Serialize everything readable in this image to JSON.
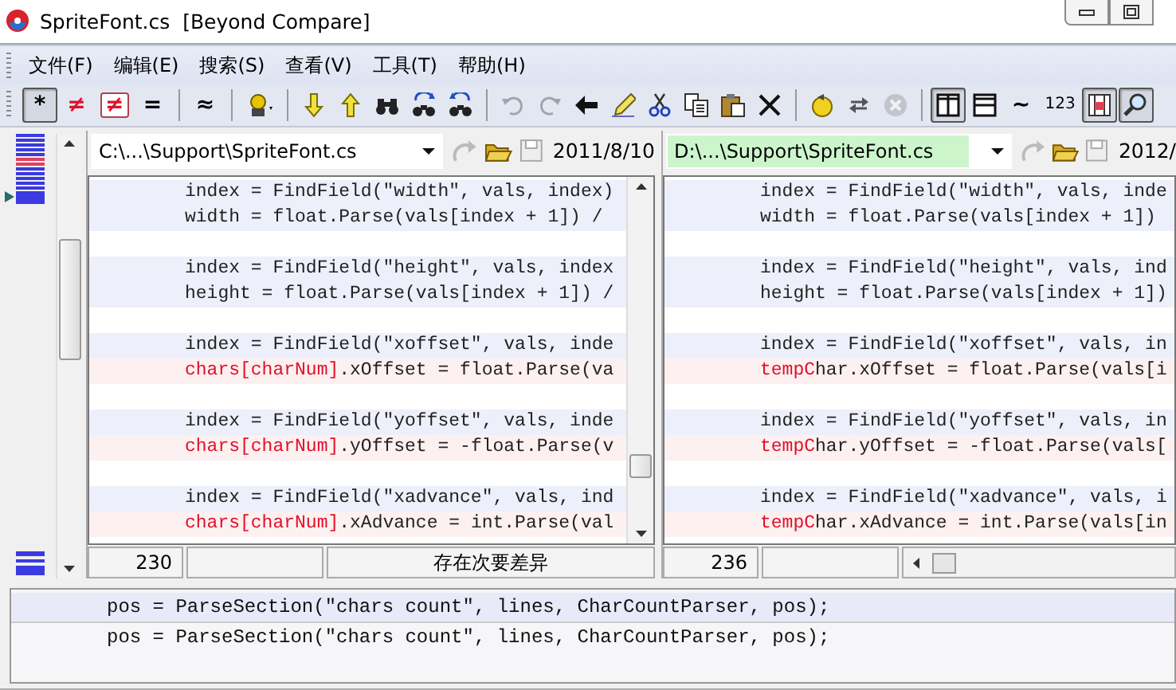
{
  "window": {
    "title": "SpriteFont.cs  [Beyond Compare]"
  },
  "menu": [
    "文件(F)",
    "编辑(E)",
    "搜索(S)",
    "查看(V)",
    "工具(T)",
    "帮助(H)"
  ],
  "toolbar": [
    {
      "kind": "glyph",
      "text": "*",
      "color": "#000000",
      "pressed": true
    },
    {
      "kind": "glyph",
      "text": "≠",
      "color": "#e0102a",
      "pressed": false
    },
    {
      "kind": "glyph-boxed",
      "text": "≠",
      "color": "#e0102a",
      "pressed": false
    },
    {
      "kind": "glyph",
      "text": "=",
      "color": "#000000",
      "pressed": false
    },
    {
      "kind": "separator"
    },
    {
      "kind": "glyph",
      "text": "≈",
      "color": "#000000",
      "pressed": false
    },
    {
      "kind": "separator"
    },
    {
      "kind": "icon",
      "pressed": false,
      "disabled": false
    },
    {
      "kind": "separator"
    },
    {
      "kind": "icon",
      "pressed": false,
      "disabled": false
    },
    {
      "kind": "icon",
      "pressed": false,
      "disabled": false
    },
    {
      "kind": "icon",
      "pressed": false,
      "disabled": false
    },
    {
      "kind": "icon",
      "pressed": false,
      "disabled": false
    },
    {
      "kind": "icon",
      "pressed": false,
      "disabled": false
    },
    {
      "kind": "separator"
    },
    {
      "kind": "icon",
      "pressed": false,
      "disabled": true
    },
    {
      "kind": "icon",
      "pressed": false,
      "disabled": true
    },
    {
      "kind": "icon",
      "pressed": false,
      "disabled": false
    },
    {
      "kind": "icon",
      "pressed": false,
      "disabled": false
    },
    {
      "kind": "icon",
      "pressed": false,
      "disabled": false
    },
    {
      "kind": "icon",
      "pressed": false,
      "disabled": false
    },
    {
      "kind": "icon",
      "pressed": false,
      "disabled": false
    },
    {
      "kind": "icon",
      "pressed": false,
      "disabled": false
    },
    {
      "kind": "separator"
    },
    {
      "kind": "icon",
      "pressed": false,
      "disabled": false
    },
    {
      "kind": "icon",
      "pressed": false,
      "disabled": false
    },
    {
      "kind": "icon",
      "pressed": false,
      "disabled": true
    },
    {
      "kind": "separator"
    },
    {
      "kind": "icon",
      "pressed": true,
      "disabled": false
    },
    {
      "kind": "icon",
      "pressed": false,
      "disabled": false
    },
    {
      "kind": "glyph",
      "text": "~",
      "color": "#000000",
      "pressed": false
    },
    {
      "kind": "glyph-small",
      "text": "123",
      "color": "#000000",
      "pressed": false
    },
    {
      "kind": "icon",
      "pressed": true,
      "disabled": false
    },
    {
      "kind": "icon",
      "pressed": true,
      "disabled": false
    }
  ],
  "panes": [
    {
      "path": "C:\\...\\Support\\SpriteFont.cs",
      "highlighted": false,
      "date": "2011/8/10",
      "vertical_scrollbar": true,
      "lines": [
        {
          "kind": "same",
          "text": "index = FindField(\"width\", vals, index)"
        },
        {
          "kind": "same",
          "text": "width = float.Parse(vals[index + 1]) /"
        },
        {
          "kind": "blank"
        },
        {
          "kind": "same",
          "text": "index = FindField(\"height\", vals, index"
        },
        {
          "kind": "same",
          "text": "height = float.Parse(vals[index + 1]) /"
        },
        {
          "kind": "blank"
        },
        {
          "kind": "same",
          "text": "index = FindField(\"xoffset\", vals, inde"
        },
        {
          "kind": "diff",
          "parts": [
            {
              "text": "chars[charNum]",
              "changed": true
            },
            {
              "text": ".xOffset = float.Parse(va",
              "changed": false
            }
          ]
        },
        {
          "kind": "blank"
        },
        {
          "kind": "same",
          "text": "index = FindField(\"yoffset\", vals, inde"
        },
        {
          "kind": "diff",
          "parts": [
            {
              "text": "chars[charNum]",
              "changed": true
            },
            {
              "text": ".yOffset = -float.Parse(v",
              "changed": false
            }
          ]
        },
        {
          "kind": "blank"
        },
        {
          "kind": "same",
          "text": "index = FindField(\"xadvance\", vals, ind"
        },
        {
          "kind": "diff",
          "parts": [
            {
              "text": "chars[charNum]",
              "changed": true
            },
            {
              "text": ".xAdvance = int.Parse(val",
              "changed": false
            }
          ]
        }
      ],
      "status": {
        "line": "230",
        "message": "存在次要差异",
        "horizontal_scrollbar": false
      }
    },
    {
      "path": "D:\\...\\Support\\SpriteFont.cs",
      "highlighted": true,
      "date": "2012/",
      "vertical_scrollbar": false,
      "lines": [
        {
          "kind": "same",
          "text": "index = FindField(\"width\", vals, inde"
        },
        {
          "kind": "same",
          "text": "width = float.Parse(vals[index + 1])"
        },
        {
          "kind": "blank"
        },
        {
          "kind": "same",
          "text": "index = FindField(\"height\", vals, ind"
        },
        {
          "kind": "same",
          "text": "height = float.Parse(vals[index + 1])"
        },
        {
          "kind": "blank"
        },
        {
          "kind": "same",
          "text": "index = FindField(\"xoffset\", vals, in"
        },
        {
          "kind": "diff",
          "parts": [
            {
              "text": "tempC",
              "changed": true
            },
            {
              "text": "har.xOffset = float.Parse(vals[i",
              "changed": false
            }
          ]
        },
        {
          "kind": "blank"
        },
        {
          "kind": "same",
          "text": "index = FindField(\"yoffset\", vals, in"
        },
        {
          "kind": "diff",
          "parts": [
            {
              "text": "tempC",
              "changed": true
            },
            {
              "text": "har.yOffset = -float.Parse(vals[",
              "changed": false
            }
          ]
        },
        {
          "kind": "blank"
        },
        {
          "kind": "same",
          "text": "index = FindField(\"xadvance\", vals, i"
        },
        {
          "kind": "diff",
          "parts": [
            {
              "text": "tempC",
              "changed": true
            },
            {
              "text": "har.xAdvance = int.Parse(vals[in",
              "changed": false
            }
          ]
        }
      ],
      "status": {
        "line": "236",
        "horizontal_scrollbar": true
      }
    }
  ],
  "compare_lines": [
    {
      "text": "pos = ParseSection(\"chars count\", lines, CharCountParser, pos);",
      "selected": true
    },
    {
      "text": "pos = ParseSection(\"chars count\", lines, CharCountParser, pos);",
      "selected": false
    }
  ]
}
